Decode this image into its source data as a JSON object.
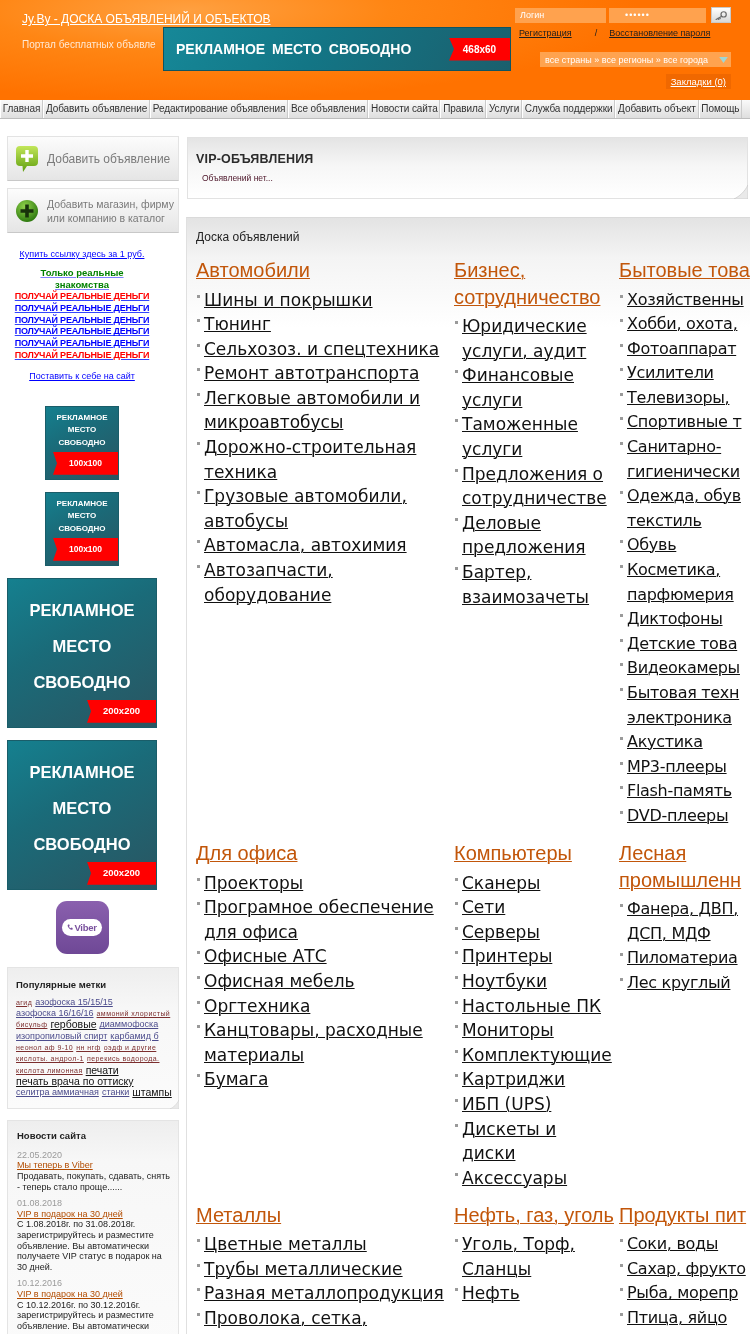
{
  "header": {
    "title": "Jy.By - ДОСКА ОБЪЯВЛЕНИЙ И ОБЪЕКТОВ",
    "subtitle": "Портал бесплатных объявле",
    "banner": {
      "text": "РЕКЛАМНОЕ МЕСТО СВОБОДНО",
      "size": "468x60"
    },
    "login": {
      "placeholder": "Логин"
    },
    "password": {
      "value": "••••••"
    },
    "register_link": "Регистрация",
    "separator": "/",
    "restore_link": "Восстановление пароля",
    "region_selector": "все страны » все регионы » все города",
    "bookmarks": "Закладки (0)"
  },
  "nav": [
    "Главная",
    "Добавить объявление",
    "Редактирование объявления",
    "Все объявления",
    "Новости сайта",
    "Правила",
    "Услуги",
    "Служба поддержки",
    "Добавить объект",
    "Помощь"
  ],
  "sidebar": {
    "buttons": [
      {
        "kind": "bubble",
        "label": "Добавить объявление"
      },
      {
        "kind": "circle",
        "label": "Добавить магазин, фирму или компанию в каталог"
      }
    ],
    "buy_link": "Купить ссылку здесь за 1 руб.",
    "promo_title": "Только реальные знакомства",
    "promo_links": [
      {
        "text": "ПОЛУЧАЙ РЕАЛЬНЫЕ ДЕНЬГИ",
        "color": "#ff0000"
      },
      {
        "text": "ПОЛУЧАЙ РЕАЛЬНЫЕ ДЕНЬГИ",
        "color": "#0000ff"
      },
      {
        "text": "ПОЛУЧАЙ РЕАЛЬНЫЕ ДЕНЬГИ",
        "color": "#0000ff"
      },
      {
        "text": "ПОЛУЧАЙ РЕАЛЬНЫЕ ДЕНЬГИ",
        "color": "#0000ff"
      },
      {
        "text": "ПОЛУЧАЙ РЕАЛЬНЫЕ ДЕНЬГИ",
        "color": "#0000ff"
      },
      {
        "text": "ПОЛУЧАЙ РЕАЛЬНЫЕ ДЕНЬГИ",
        "color": "#ff0000"
      }
    ],
    "install_link": "Поставить к себе на сайт",
    "ads": [
      {
        "kind": "small",
        "text": "РЕКЛАМНОЕ МЕСТО СВОБОДНО",
        "size": "100x100"
      },
      {
        "kind": "small",
        "text": "РЕКЛАМНОЕ МЕСТО СВОБОДНО",
        "size": "100x100"
      },
      {
        "kind": "large",
        "text": "РЕКЛАМНОЕ МЕСТО СВОБОДНО",
        "size": "200x200"
      },
      {
        "kind": "large",
        "text": "РЕКЛАМНОЕ МЕСТО СВОБОДНО",
        "size": "200x200"
      }
    ],
    "viber": {
      "label": "Viber"
    },
    "tags": {
      "title": "Популярные метки",
      "items": [
        {
          "text": "агид",
          "kind": "small"
        },
        {
          "text": "азофоска 15/15/15",
          "kind": "medium"
        },
        {
          "text": "азофоска 16/16/16",
          "kind": "medium"
        },
        {
          "text": "аммоний хлористый",
          "kind": "small"
        },
        {
          "text": "бисульф",
          "kind": "small"
        },
        {
          "text": "гербовые",
          "kind": "large"
        },
        {
          "text": "диаммофоска",
          "kind": "medium"
        },
        {
          "text": "изопропиловый спирт",
          "kind": "medium"
        },
        {
          "text": "карбамид б",
          "kind": "medium"
        },
        {
          "text": "неонол аф 9-10",
          "kind": "small"
        },
        {
          "text": "нн нгф",
          "kind": "small"
        },
        {
          "text": "оэдф и другие",
          "kind": "small"
        },
        {
          "text": "кислоты. андрол-1",
          "kind": "small"
        },
        {
          "text": "перекись водорода.",
          "kind": "small"
        },
        {
          "text": "кислота лимонная",
          "kind": "small"
        },
        {
          "text": "печати",
          "kind": "large"
        },
        {
          "text": "печать врача по оттиску",
          "kind": "large"
        },
        {
          "text": "селитра аммиачная",
          "kind": "medium"
        },
        {
          "text": "станки",
          "kind": "medium"
        },
        {
          "text": "штампы",
          "kind": "large"
        }
      ]
    },
    "news": {
      "title": "Новости сайта",
      "items": [
        {
          "date": "22.05.2020",
          "title": "Мы теперь в Viber",
          "text": "Продавать, покупать, сдавать, снять - теперь стало проще......"
        },
        {
          "date": "01.08.2018",
          "title": "VIP в подарок на 30 дней",
          "text": "С 1.08.2018г. по 31.08.2018г. зарегистрируйтесь и разместите объявление. Вы автоматически получаете VIP статус в подарок на 30 дней."
        },
        {
          "date": "10.12.2016",
          "title": "VIP в подарок на 30 дней",
          "text": "С 10.12.2016г. по 30.12.2016г. зарегистрируйтесь и разместите объявление. Вы автоматически"
        }
      ]
    }
  },
  "main": {
    "vip": {
      "title": "VIP-ОБЪЯВЛЕНИЯ",
      "empty_text": "Объявлений нет..."
    },
    "board": {
      "title": "Доска объявлений",
      "categories": [
        {
          "title": "Автомобили",
          "items": [
            "Шины и покрышки",
            "Тюнинг",
            "Сельхозоз. и спецтехника",
            "Ремонт автотранспорта",
            "Легковые автомобили и микроавтобусы",
            "Дорожно-строительная техника",
            "Грузовые автомобили, автобусы",
            "Автомасла, автохимия",
            "Автозапчасти, оборудование"
          ]
        },
        {
          "title": "Бизнес, сотрудничество",
          "items": [
            "Юридические услуги, аудит",
            "Финансовые услуги",
            "Таможенные услуги",
            "Предложения о сотрудничестве",
            "Деловые предложения",
            "Бартер, взаимозачеты"
          ]
        },
        {
          "title": "Бытовые това",
          "items": [
            "Хозяйственны",
            "Хобби, охота,",
            "Фотоаппарат",
            "Усилители",
            "Телевизоры,",
            "Спортивные т",
            "Санитарно-гигиенически",
            "Одежда, обув текстиль",
            "Обувь",
            "Косметика, парфюмерия",
            "Диктофоны",
            "Детские това",
            "Видеокамеры",
            "Бытовая техн электроника",
            "Акустика",
            "MP3-плееры",
            "Flash-память",
            "DVD-плееры"
          ]
        },
        {
          "title": "Для офиса",
          "items": [
            "Проекторы",
            "Програмное обеспечение для офиса",
            "Офисные АТС",
            "Офисная мебель",
            "Оргтехника",
            "Канцтовары, расходные материалы",
            "Бумага"
          ]
        },
        {
          "title": "Компьютеры",
          "items": [
            "Сканеры",
            "Сети",
            "Серверы",
            "Принтеры",
            "Ноутбуки",
            "Настольные ПК",
            "Мониторы",
            "Комплектующие",
            "Картриджи",
            "ИБП (UPS)",
            "Дискеты и диски",
            "Аксессуары"
          ]
        },
        {
          "title": "Лесная промышленн",
          "items": [
            "Фанера, ДВП, ДСП, МДФ",
            "Пиломатериа",
            "Лес круглый"
          ]
        },
        {
          "title": "Металлы",
          "items": [
            "Цветные металлы",
            "Трубы металлические",
            "Разная металлопродукция",
            "Проволока, сетка,"
          ]
        },
        {
          "title": "Нефть, газ, уголь",
          "items": [
            "Уголь, Торф, Сланцы",
            "Нефть"
          ]
        },
        {
          "title": "Продукты пит",
          "items": [
            "Соки, воды",
            "Сахар, фрукто",
            "Рыба, морепр",
            "Птица, яйцо"
          ]
        }
      ]
    }
  }
}
